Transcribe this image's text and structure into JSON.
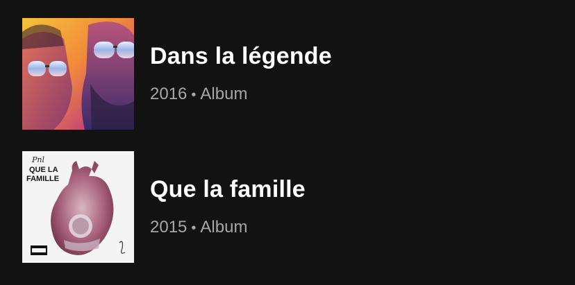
{
  "albums": [
    {
      "title": "Dans la légende",
      "year": "2016",
      "separator": "•",
      "type": "Album",
      "cover_icon": "album-cover-two-men-sunglasses"
    },
    {
      "title": "Que la famille",
      "year": "2015",
      "separator": "•",
      "type": "Album",
      "cover_text_top": "Pnl",
      "cover_text_line1": "QUE LA",
      "cover_text_line2": "FAMILLE",
      "cover_icon": "album-cover-heart"
    }
  ],
  "colors": {
    "background": "#121212",
    "title": "#ffffff",
    "subtitle": "#a7a7a7"
  }
}
